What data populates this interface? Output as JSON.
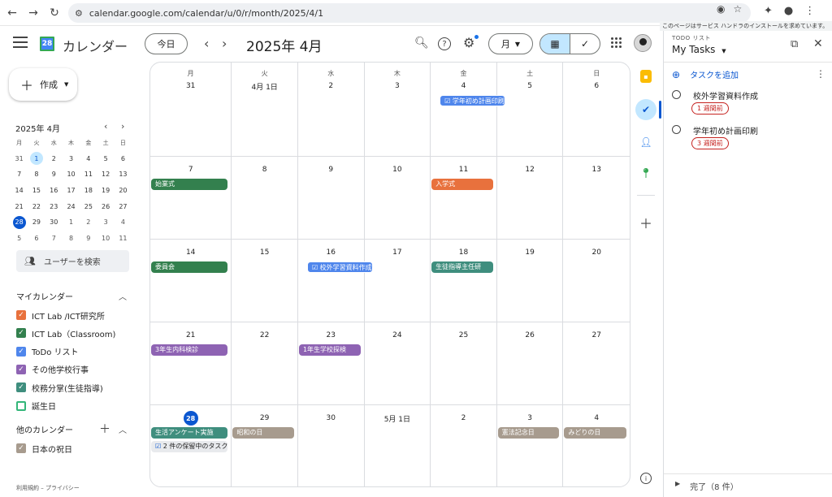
{
  "browser": {
    "url": "calendar.google.com/calendar/u/0/r/month/2025/4/1",
    "tooltip": "このページはサービス ハンドラのインストールを求めています。"
  },
  "header": {
    "app_title": "カレンダー",
    "logo_num": "28",
    "today_label": "今日",
    "month_title": "2025年 4月",
    "view_label": "月"
  },
  "sidebar": {
    "create_label": "作成",
    "mini_title": "2025年 4月",
    "mini_dow": [
      "月",
      "火",
      "水",
      "木",
      "金",
      "土",
      "日"
    ],
    "mini_days": [
      "31",
      "1",
      "2",
      "3",
      "4",
      "5",
      "6",
      "7",
      "8",
      "9",
      "10",
      "11",
      "12",
      "13",
      "14",
      "15",
      "16",
      "17",
      "18",
      "19",
      "20",
      "21",
      "22",
      "23",
      "24",
      "25",
      "26",
      "27",
      "28",
      "29",
      "30",
      "1",
      "2",
      "3",
      "4",
      "5",
      "6",
      "7",
      "8",
      "9",
      "10",
      "11"
    ],
    "search_users": "ユーザーを検索",
    "my_calendars_title": "マイカレンダー",
    "my_calendars": [
      {
        "name": "ICT Lab /ICT研究所",
        "color": "#e8713d",
        "checked": true
      },
      {
        "name": "ICT Lab（Classroom)",
        "color": "#33804e",
        "checked": true
      },
      {
        "name": "ToDo リスト",
        "color": "#4f86ec",
        "checked": true
      },
      {
        "name": "その他学校行事",
        "color": "#8e63b3",
        "checked": true
      },
      {
        "name": "校務分掌(生徒指導)",
        "color": "#3f8e7e",
        "checked": true
      },
      {
        "name": "誕生日",
        "color": "#33b679",
        "checked": false
      }
    ],
    "other_calendars_title": "他のカレンダー",
    "other_calendars": [
      {
        "name": "日本の祝日",
        "color": "#a79b8e",
        "checked": true
      }
    ],
    "footer": "利用規約 – プライバシー"
  },
  "month": {
    "dow": [
      "月",
      "火",
      "水",
      "木",
      "金",
      "土",
      "日"
    ],
    "days": [
      {
        "n": "31"
      },
      {
        "n": "4月 1日"
      },
      {
        "n": "2"
      },
      {
        "n": "3"
      },
      {
        "n": "4",
        "events": [
          {
            "t": "学年初め計画印刷",
            "c": "#4f86ec",
            "task": true
          }
        ]
      },
      {
        "n": "5"
      },
      {
        "n": "6"
      },
      {
        "n": "7",
        "events": [
          {
            "t": "始業式",
            "c": "#33804e"
          }
        ]
      },
      {
        "n": "8"
      },
      {
        "n": "9"
      },
      {
        "n": "10"
      },
      {
        "n": "11",
        "events": [
          {
            "t": "入学式",
            "c": "#e8713d"
          }
        ]
      },
      {
        "n": "12"
      },
      {
        "n": "13"
      },
      {
        "n": "14",
        "events": [
          {
            "t": "委員会",
            "c": "#33804e"
          }
        ]
      },
      {
        "n": "15"
      },
      {
        "n": "16",
        "events": [
          {
            "t": "校外学習資料作成",
            "c": "#4f86ec",
            "task": true
          }
        ]
      },
      {
        "n": "17"
      },
      {
        "n": "18",
        "events": [
          {
            "t": "生徒指導主任研",
            "c": "#3f8e7e"
          }
        ]
      },
      {
        "n": "19"
      },
      {
        "n": "20"
      },
      {
        "n": "21",
        "events": [
          {
            "t": "3年生内科検診",
            "c": "#8e63b3"
          }
        ]
      },
      {
        "n": "22"
      },
      {
        "n": "23",
        "events": [
          {
            "t": "1年生学校探検",
            "c": "#8e63b3"
          }
        ]
      },
      {
        "n": "24"
      },
      {
        "n": "25"
      },
      {
        "n": "26"
      },
      {
        "n": "27"
      },
      {
        "n": "28",
        "today": true,
        "events": [
          {
            "t": "生活アンケート実施",
            "c": "#3f8e7e"
          },
          {
            "t": "2 件の保留中のタスク",
            "c": "",
            "pending": true
          }
        ]
      },
      {
        "n": "29",
        "events": [
          {
            "t": "昭和の日",
            "c": "#a79b8e"
          }
        ]
      },
      {
        "n": "30"
      },
      {
        "n": "5月 1日"
      },
      {
        "n": "2"
      },
      {
        "n": "3",
        "events": [
          {
            "t": "憲法記念日",
            "c": "#a79b8e"
          }
        ]
      },
      {
        "n": "4",
        "events": [
          {
            "t": "みどりの日",
            "c": "#a79b8e"
          }
        ]
      }
    ]
  },
  "tasks": {
    "label": "TODO リスト",
    "title": "My Tasks",
    "add_label": "タスクを追加",
    "items": [
      {
        "title": "校外学習資料作成",
        "due": "1 週間前"
      },
      {
        "title": "学年初め計画印刷",
        "due": "3 週間前"
      }
    ],
    "completed": "完了（8 件）"
  }
}
